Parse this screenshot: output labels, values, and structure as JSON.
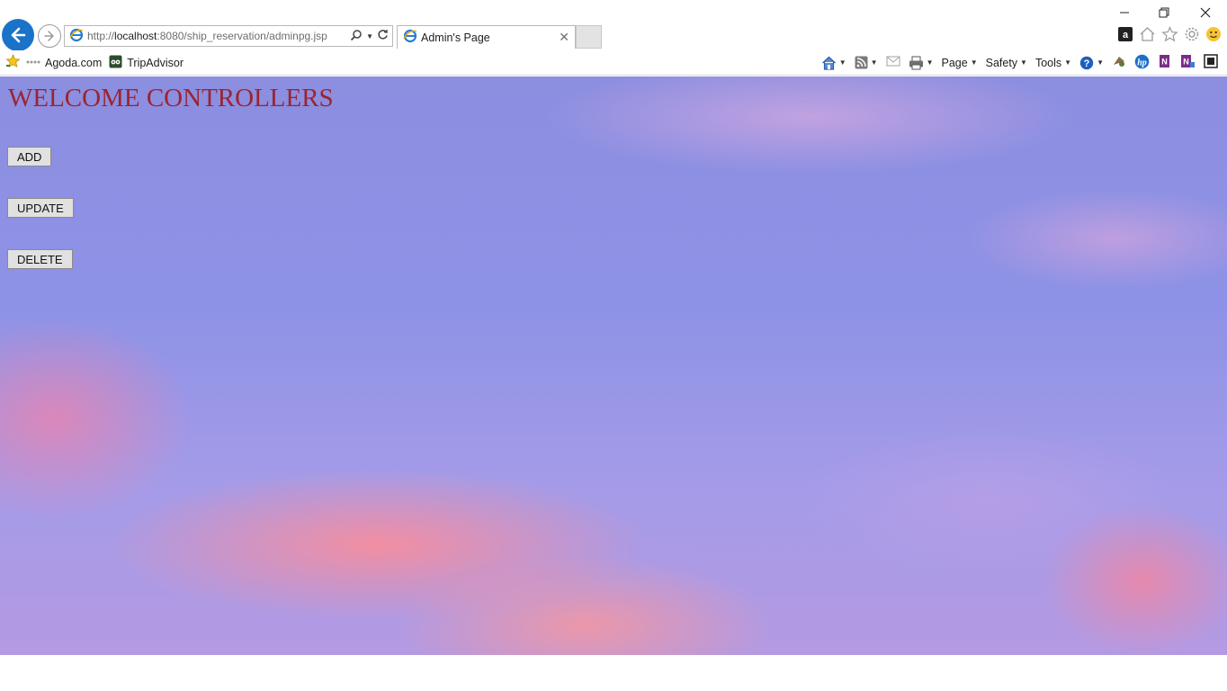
{
  "browser": {
    "url_prefix": "http://",
    "url_host": "localhost",
    "url_rest": ":8080/ship_reservation/adminpg.jsp",
    "tab_title": "Admin's Page",
    "favorites": [
      {
        "label": "Agoda.com",
        "icon": "agoda-icon"
      },
      {
        "label": "TripAdvisor",
        "icon": "tripadvisor-icon"
      }
    ],
    "menus": {
      "page": "Page",
      "safety": "Safety",
      "tools": "Tools"
    }
  },
  "page": {
    "heading": "WELCOME CONTROLLERS",
    "buttons": {
      "add": "ADD",
      "update": "UPDATE",
      "delete": "DELETE"
    },
    "colors": {
      "heading": "#9b2430",
      "back_button": "#1a73c9"
    }
  }
}
